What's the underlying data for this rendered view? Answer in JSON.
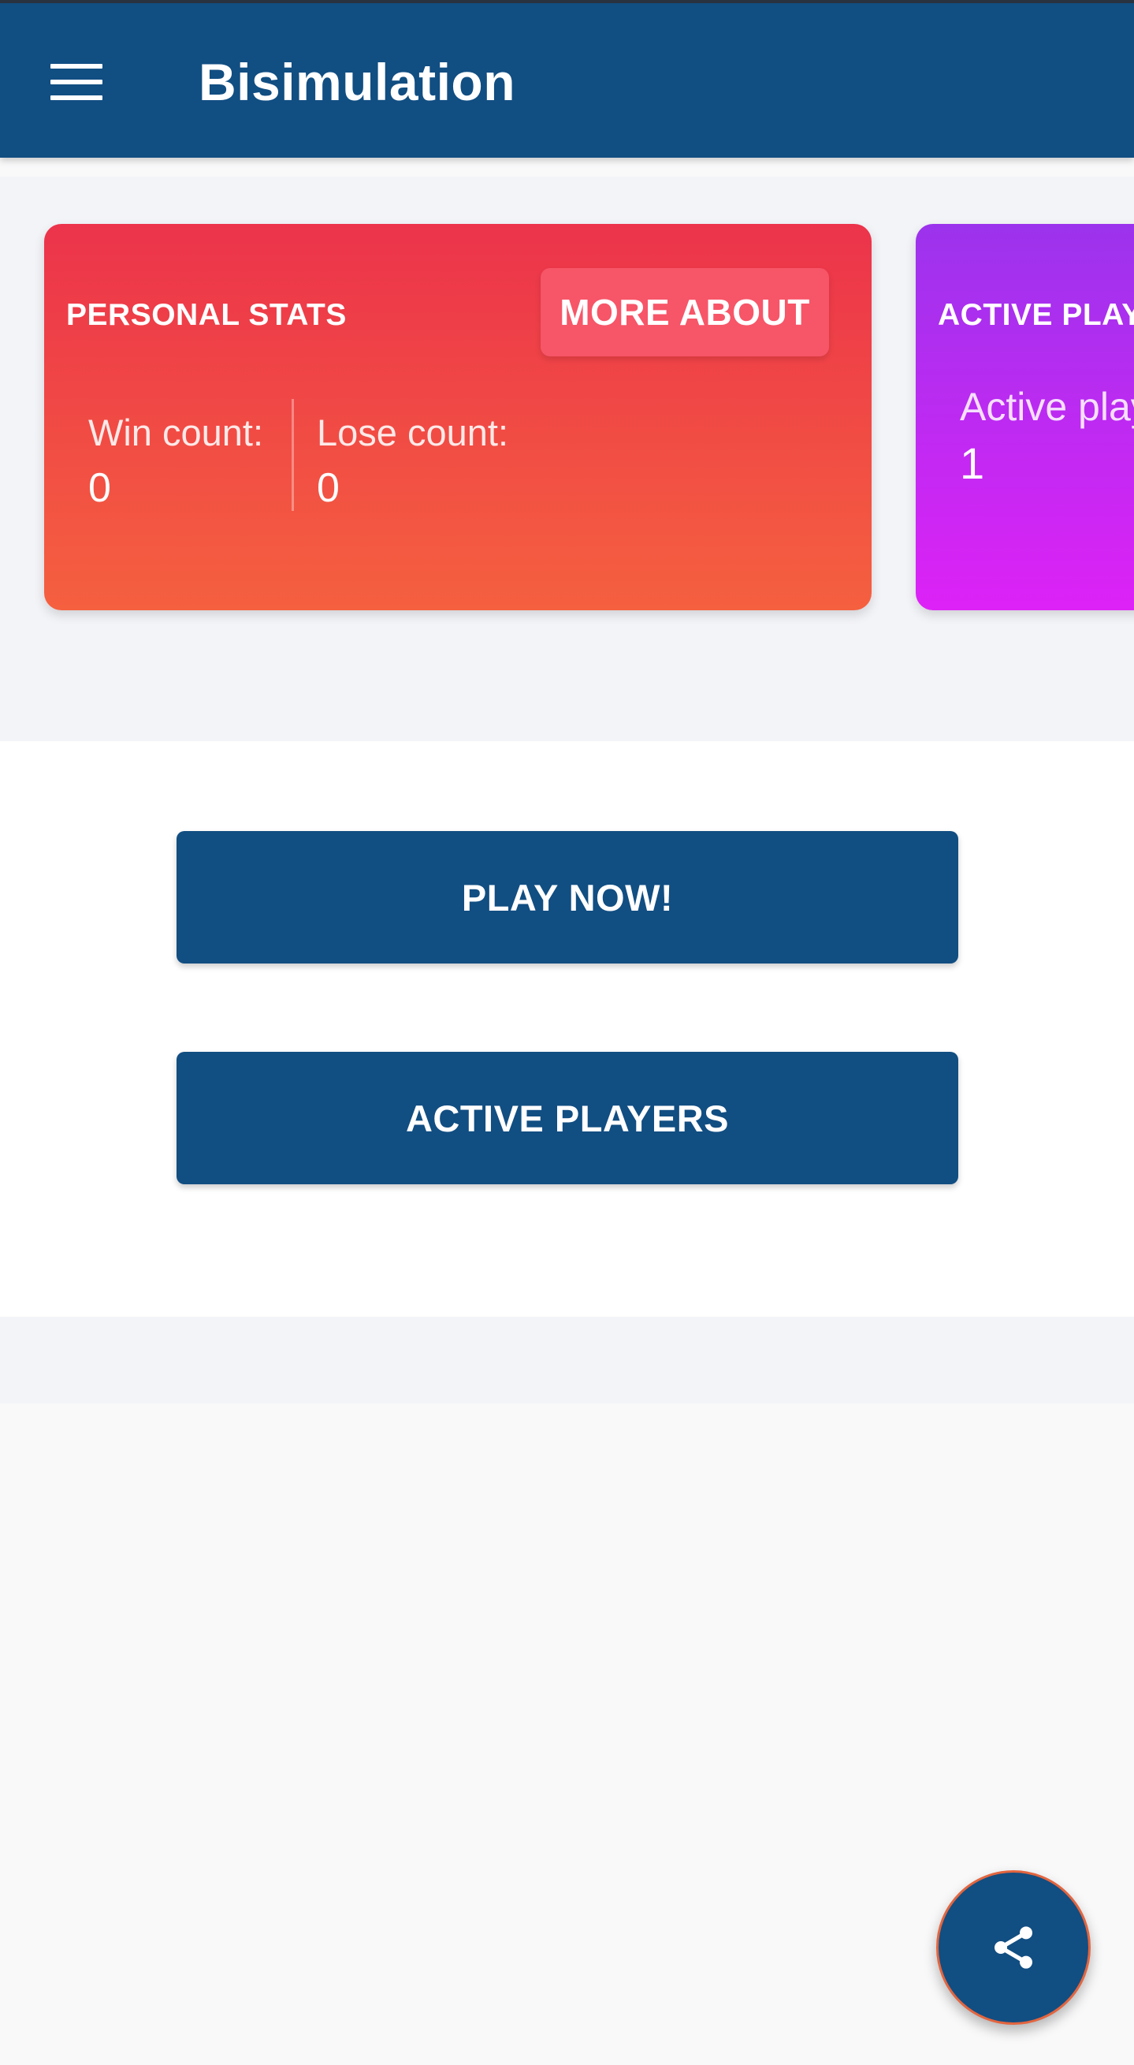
{
  "app_bar": {
    "title": "Bisimulation",
    "menu_icon": "hamburger-menu-icon",
    "background": "#114e82"
  },
  "cards": {
    "personal_stats": {
      "title": "PERSONAL STATS",
      "more_button": "MORE ABOUT",
      "win_label": "Win count:",
      "win_value": "0",
      "lose_label": "Lose count:",
      "lose_value": "0",
      "gradient": [
        "#ec334b",
        "#f5603f"
      ]
    },
    "active_players": {
      "title": "ACTIVE PLAY",
      "label": "Active play",
      "value": "1",
      "gradient": [
        "#9c33ec",
        "#dd22f6"
      ]
    }
  },
  "actions": {
    "play_now": "PLAY NOW!",
    "active_players": "ACTIVE PLAYERS"
  },
  "fab": {
    "icon": "share-icon",
    "accent": "#114e82"
  }
}
